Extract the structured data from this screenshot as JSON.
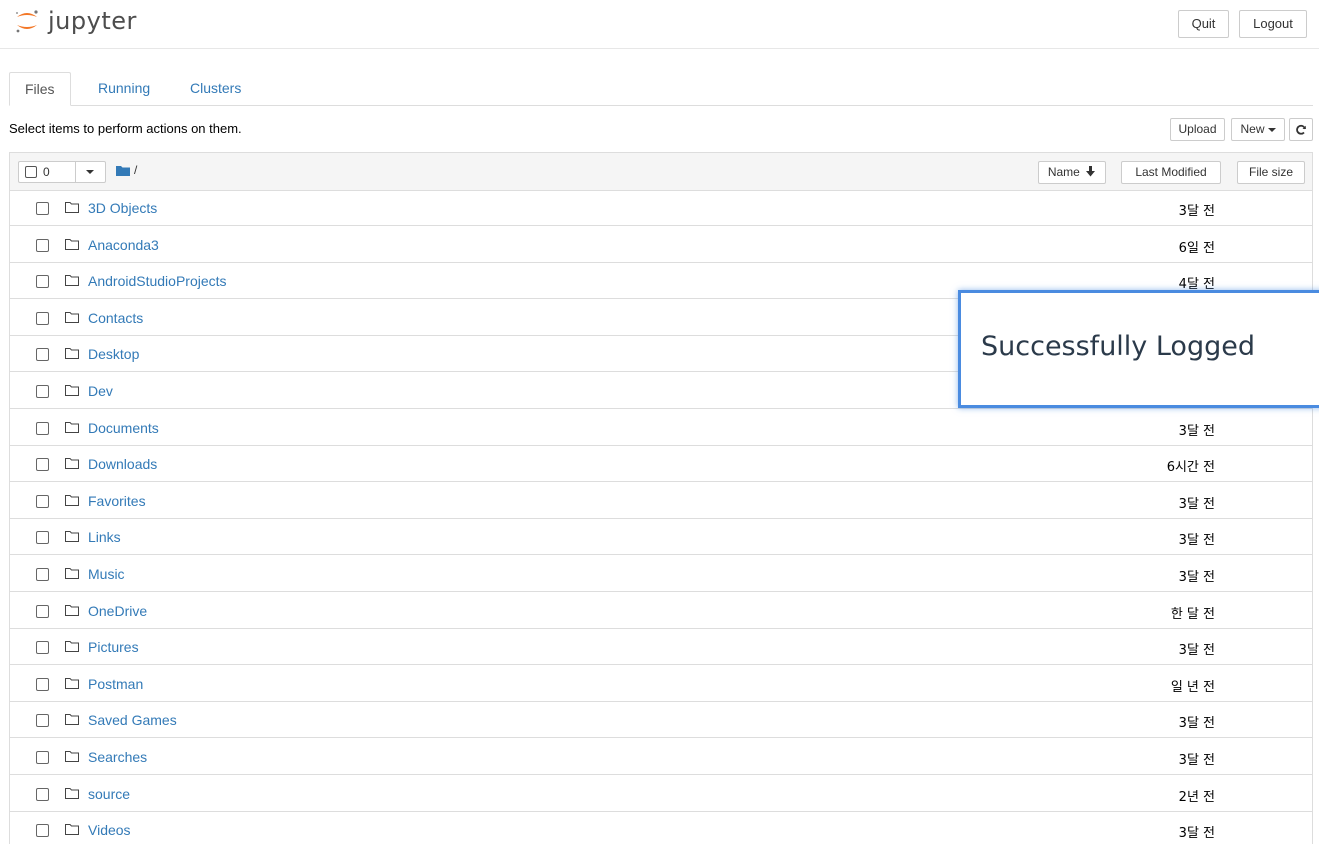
{
  "header": {
    "logo_text": "jupyter",
    "quit_label": "Quit",
    "logout_label": "Logout"
  },
  "tabs": [
    {
      "label": "Files",
      "active": true
    },
    {
      "label": "Running",
      "active": false
    },
    {
      "label": "Clusters",
      "active": false
    }
  ],
  "toolbar": {
    "select_note": "Select items to perform actions on them.",
    "upload_label": "Upload",
    "new_label": "New",
    "refresh_icon": "refresh-icon"
  },
  "list_header": {
    "selected_count": "0",
    "breadcrumb": "/",
    "sort_name_label": "Name",
    "sort_name_icon": "arrow-down-icon",
    "sort_modified_label": "Last Modified",
    "sort_size_label": "File size"
  },
  "files": [
    {
      "name": "3D Objects",
      "modified": "3달 전"
    },
    {
      "name": "Anaconda3",
      "modified": "6일 전"
    },
    {
      "name": "AndroidStudioProjects",
      "modified": "4달 전"
    },
    {
      "name": "Contacts",
      "modified": ""
    },
    {
      "name": "Desktop",
      "modified": ""
    },
    {
      "name": "Dev",
      "modified": ""
    },
    {
      "name": "Documents",
      "modified": "3달 전"
    },
    {
      "name": "Downloads",
      "modified": "6시간 전"
    },
    {
      "name": "Favorites",
      "modified": "3달 전"
    },
    {
      "name": "Links",
      "modified": "3달 전"
    },
    {
      "name": "Music",
      "modified": "3달 전"
    },
    {
      "name": "OneDrive",
      "modified": "한 달 전"
    },
    {
      "name": "Pictures",
      "modified": "3달 전"
    },
    {
      "name": "Postman",
      "modified": "일 년 전"
    },
    {
      "name": "Saved Games",
      "modified": "3달 전"
    },
    {
      "name": "Searches",
      "modified": "3달 전"
    },
    {
      "name": "source",
      "modified": "2년 전"
    },
    {
      "name": "Videos",
      "modified": "3달 전"
    }
  ],
  "notification": {
    "text": "Successfully Logged"
  },
  "colors": {
    "link": "#337ab7",
    "accent_border": "#4a8be0",
    "jupyter_orange": "#f37726"
  }
}
